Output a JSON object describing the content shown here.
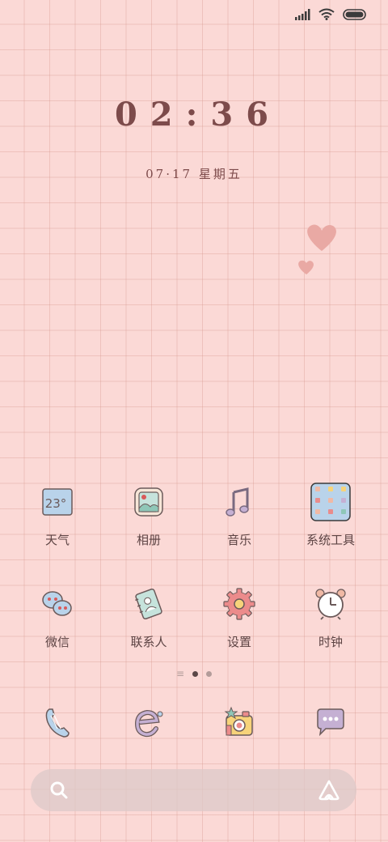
{
  "lockscreen": {
    "time": "02:36",
    "date": "07·17 星期五"
  },
  "apps_row1": [
    {
      "label": "天气",
      "icon": "weather-icon",
      "temp": "23°"
    },
    {
      "label": "相册",
      "icon": "gallery-icon"
    },
    {
      "label": "音乐",
      "icon": "music-icon"
    },
    {
      "label": "系统工具",
      "icon": "system-tools-folder-icon"
    }
  ],
  "apps_row2": [
    {
      "label": "微信",
      "icon": "wechat-icon"
    },
    {
      "label": "联系人",
      "icon": "contacts-icon"
    },
    {
      "label": "设置",
      "icon": "settings-icon"
    },
    {
      "label": "时钟",
      "icon": "clock-icon"
    }
  ],
  "dock": [
    {
      "icon": "phone-icon"
    },
    {
      "icon": "browser-icon"
    },
    {
      "icon": "camera-icon"
    },
    {
      "icon": "messages-icon"
    }
  ],
  "pager": {
    "pages": 2,
    "active": 0
  },
  "colors": {
    "background": "#fbd9d6",
    "grid": "#d6968c",
    "text_dark": "#7d4b4b",
    "heart": "#e9a9a4"
  }
}
